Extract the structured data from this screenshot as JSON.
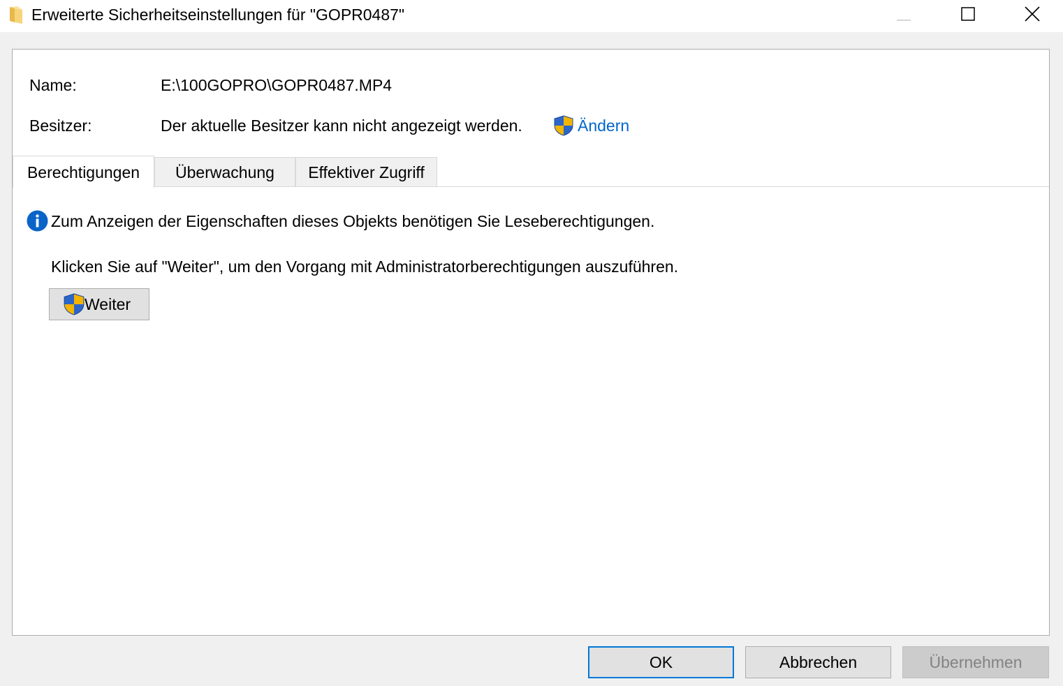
{
  "window": {
    "title": "Erweiterte Sicherheitseinstellungen für \"GOPR0487\"",
    "icon": "folder-icon",
    "controls": {
      "minimize_icon": "minimize-icon",
      "maximize_icon": "maximize-icon",
      "close_icon": "close-icon"
    }
  },
  "properties": {
    "name_label": "Name:",
    "name_value": "E:\\100GOPRO\\GOPR0487.MP4",
    "owner_label": "Besitzer:",
    "owner_value": "Der aktuelle Besitzer kann nicht angezeigt werden.",
    "change_link": "Ändern"
  },
  "tabs": [
    {
      "label": "Berechtigungen",
      "active": true
    },
    {
      "label": "Überwachung",
      "active": false
    },
    {
      "label": "Effektiver Zugriff",
      "active": false
    }
  ],
  "content": {
    "info_message": "Zum Anzeigen der Eigenschaften dieses Objekts benötigen Sie Leseberechtigungen.",
    "continue_hint": "Klicken Sie auf \"Weiter\", um den Vorgang mit Administratorberechtigungen auszuführen.",
    "continue_button": "Weiter"
  },
  "footer": {
    "ok": "OK",
    "cancel": "Abbrechen",
    "apply": "Übernehmen"
  },
  "colors": {
    "link": "#0066cc",
    "focus_border": "#0078d7",
    "info_blue": "#0a64c8",
    "shield_blue": "#2b66c8",
    "shield_yellow": "#f4b400"
  }
}
